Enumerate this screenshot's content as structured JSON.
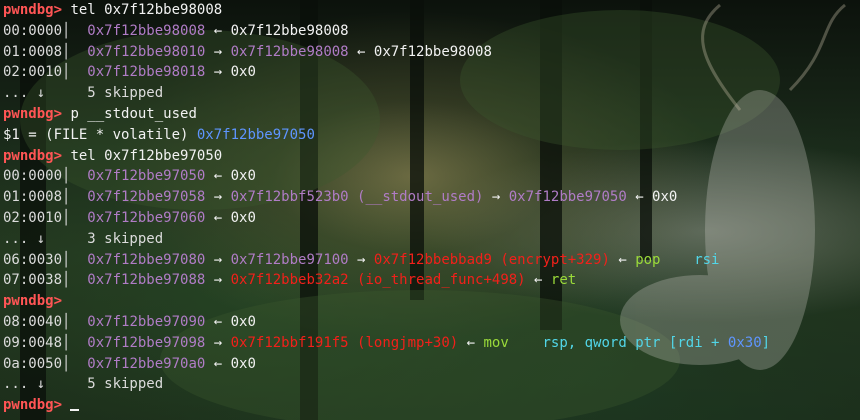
{
  "terminal": {
    "prompt": "pwndbg>",
    "lines": [
      {
        "type": "cmd",
        "text": "tel 0x7f12bbe98008"
      },
      {
        "type": "row",
        "offset": "00:0000",
        "addr": "0x7f12bbe98008",
        "chain": [
          {
            "sym": "←",
            "text": " 0x7f12bbe98008",
            "color": "white"
          }
        ]
      },
      {
        "type": "row",
        "offset": "01:0008",
        "addr": "0x7f12bbe98010",
        "chain": [
          {
            "sym": "→",
            "text": " 0x7f12bbe98008",
            "color": "purple"
          },
          {
            "sym": "←",
            "text": " 0x7f12bbe98008",
            "color": "white"
          }
        ]
      },
      {
        "type": "row",
        "offset": "02:0010",
        "addr": "0x7f12bbe98018",
        "chain": [
          {
            "sym": "→",
            "text": " 0x0",
            "color": "white"
          }
        ]
      },
      {
        "type": "skip",
        "text": "... ↓     5 skipped"
      },
      {
        "type": "cmd",
        "text": "p __stdout_used"
      },
      {
        "type": "plain",
        "text": "$1 = (FILE * volatile) ",
        "value": "0x7f12bbe97050"
      },
      {
        "type": "cmd",
        "text": "tel 0x7f12bbe97050"
      },
      {
        "type": "row",
        "offset": "00:0000",
        "addr": "0x7f12bbe97050",
        "chain": [
          {
            "sym": "←",
            "text": " 0x0",
            "color": "white"
          }
        ]
      },
      {
        "type": "row",
        "offset": "01:0008",
        "addr": "0x7f12bbe97058",
        "chain": [
          {
            "sym": "→",
            "text": " 0x7f12bbf523b0 (__stdout_used)",
            "color": "purple"
          },
          {
            "sym": "→",
            "text": " 0x7f12bbe97050",
            "color": "purple"
          },
          {
            "sym": "←",
            "text": " 0x0",
            "color": "white"
          }
        ]
      },
      {
        "type": "row",
        "offset": "02:0010",
        "addr": "0x7f12bbe97060",
        "chain": [
          {
            "sym": "←",
            "text": " 0x0",
            "color": "white"
          }
        ]
      },
      {
        "type": "skip",
        "text": "... ↓     3 skipped"
      },
      {
        "type": "row",
        "offset": "06:0030",
        "addr": "0x7f12bbe97080",
        "chain": [
          {
            "sym": "→",
            "text": " 0x7f12bbe97100",
            "color": "purple"
          },
          {
            "sym": "→",
            "text": " 0x7f12bbebbad9 (encrypt+329)",
            "color": "red"
          },
          {
            "sym": "←",
            "text": " pop",
            "color": "green"
          },
          {
            "sym": "",
            "text": "    rsi",
            "color": "cyan"
          }
        ]
      },
      {
        "type": "row",
        "offset": "07:0038",
        "addr": "0x7f12bbe97088",
        "chain": [
          {
            "sym": "→",
            "text": " 0x7f12bbeb32a2 (io_thread_func+498)",
            "color": "red"
          },
          {
            "sym": "←",
            "text": " ret",
            "color": "green"
          }
        ]
      },
      {
        "type": "cmd",
        "text": ""
      },
      {
        "type": "row",
        "offset": "08:0040",
        "addr": "0x7f12bbe97090",
        "chain": [
          {
            "sym": "←",
            "text": " 0x0",
            "color": "white"
          }
        ]
      },
      {
        "type": "row",
        "offset": "09:0048",
        "addr": "0x7f12bbe97098",
        "chain": [
          {
            "sym": "→",
            "text": " 0x7f12bbf191f5 (longjmp+30)",
            "color": "red"
          },
          {
            "sym": "←",
            "text": " mov",
            "color": "green"
          },
          {
            "sym": "",
            "text": "    rsp, qword ptr [rdi + ",
            "color": "cyan"
          },
          {
            "sym": "",
            "text": "0x30",
            "color": "blue"
          },
          {
            "sym": "",
            "text": "]",
            "color": "cyan"
          }
        ]
      },
      {
        "type": "row",
        "offset": "0a:0050",
        "addr": "0x7f12bbe970a0",
        "chain": [
          {
            "sym": "←",
            "text": " 0x0",
            "color": "white"
          }
        ]
      },
      {
        "type": "skip",
        "text": "... ↓     5 skipped"
      },
      {
        "type": "cmdcursor",
        "text": ""
      }
    ]
  }
}
